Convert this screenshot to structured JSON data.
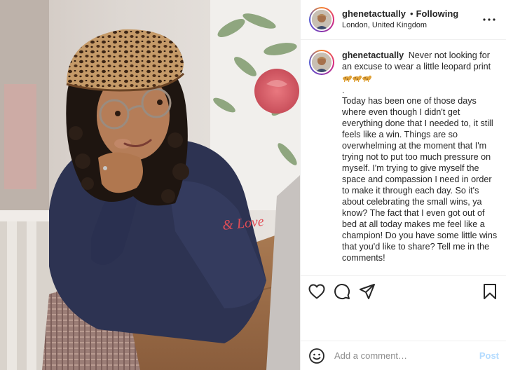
{
  "post": {
    "username": "ghenetactually",
    "separator": "•",
    "follow_status": "Following",
    "location": "London, United Kingdom",
    "caption": {
      "first_line": "Never not looking for an excuse to wear a little leopard print",
      "emoji": [
        "leopard-emoji",
        "leopard-emoji",
        "leopard-emoji"
      ],
      "dot": ".",
      "body": "Today has been one of those days where even though I didn't get everything done that I needed to, it still feels like a win. Things are so overwhelming at the moment that I'm trying not to put too much pressure on myself. I'm trying to give myself the space and compassion I need in order to make it through each day. So it's about celebrating the small wins, ya know? The fact that I even got out of bed at all today makes me feel like a champion! Do you have some little wins that you'd like to share? Tell me in the comments!"
    },
    "photo": {
      "sweater_text": "& Love"
    }
  },
  "actions": {
    "icons": [
      "heart-icon",
      "comment-icon",
      "share-icon",
      "bookmark-icon"
    ]
  },
  "comment_bar": {
    "placeholder": "Add a comment…",
    "post_label": "Post"
  },
  "colors": {
    "accent_disabled": "#b3dbff",
    "text": "#262626",
    "secondary_text": "#8e8e8e",
    "divider": "#efefef"
  }
}
